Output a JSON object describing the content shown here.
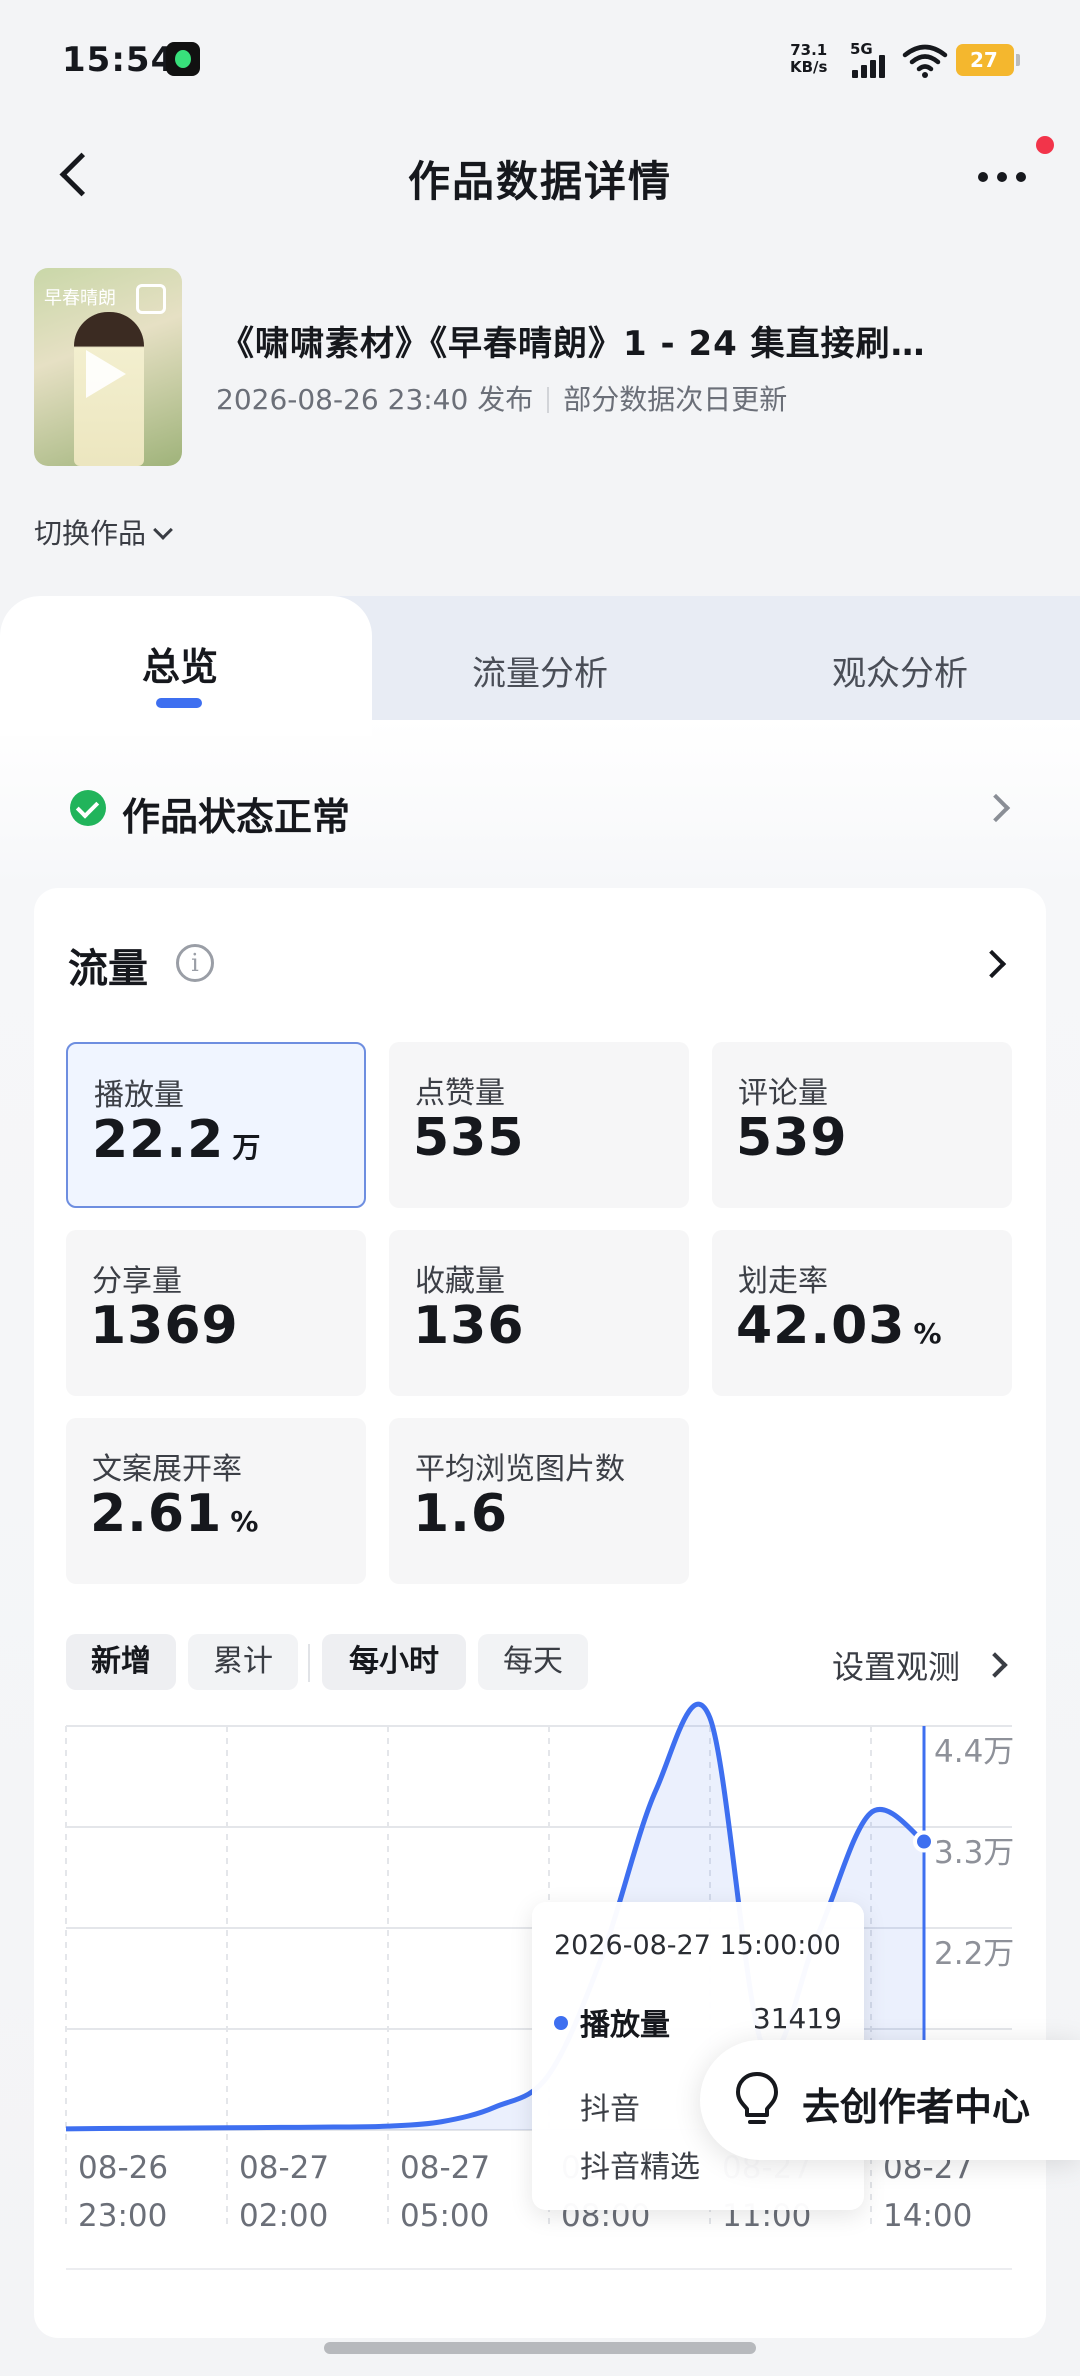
{
  "status_bar": {
    "time": "15:54",
    "net_speed_value": "73.1",
    "net_speed_unit": "KB/s",
    "network": "5G",
    "battery": "27",
    "icons": [
      "app-notification-icon",
      "signal-icon",
      "wifi-icon",
      "battery-icon"
    ]
  },
  "nav": {
    "title": "作品数据详情",
    "back_icon": "chevron-left-icon",
    "more_icon": "more-dots-icon"
  },
  "work": {
    "thumb_label": "早春晴朗",
    "title": "《啸啸素材》《早春晴朗》1 - 24 集直接刷…",
    "publish_time": "2026-08-26 23:40 发布",
    "note": "部分数据次日更新",
    "switch_label": "切换作品"
  },
  "tabs": [
    {
      "label": "总览",
      "active": true
    },
    {
      "label": "流量分析",
      "active": false
    },
    {
      "label": "观众分析",
      "active": false
    }
  ],
  "status": {
    "text": "作品状态正常"
  },
  "traffic": {
    "title": "流量",
    "metrics": [
      {
        "label": "播放量",
        "value": "22.2",
        "unit": "万",
        "selected": true
      },
      {
        "label": "点赞量",
        "value": "535",
        "unit": ""
      },
      {
        "label": "评论量",
        "value": "539",
        "unit": ""
      },
      {
        "label": "分享量",
        "value": "1369",
        "unit": ""
      },
      {
        "label": "收藏量",
        "value": "136",
        "unit": ""
      },
      {
        "label": "划走率",
        "value": "42.03",
        "unit": "%"
      },
      {
        "label": "文案展开率",
        "value": "2.61",
        "unit": "%"
      },
      {
        "label": "平均浏览图片数",
        "value": "1.6",
        "unit": ""
      }
    ],
    "chips": {
      "new": "新增",
      "cumulative": "累计",
      "hourly": "每小时",
      "daily": "每天"
    },
    "set_observe": "设置观测"
  },
  "chart_data": {
    "type": "area",
    "series": [
      {
        "name": "播放量",
        "x": [
          "2026-08-26 23:00",
          "2026-08-27 00:00",
          "2026-08-27 01:00",
          "2026-08-27 02:00",
          "2026-08-27 03:00",
          "2026-08-27 04:00",
          "2026-08-27 05:00",
          "2026-08-27 06:00",
          "2026-08-27 07:00",
          "2026-08-27 08:00",
          "2026-08-27 09:00",
          "2026-08-27 10:00",
          "2026-08-27 11:00",
          "2026-08-27 12:00",
          "2026-08-27 13:00",
          "2026-08-27 14:00",
          "2026-08-27 15:00"
        ],
        "values": [
          120,
          180,
          200,
          240,
          280,
          320,
          420,
          900,
          2500,
          6000,
          19000,
          37000,
          45000,
          9000,
          21000,
          34500,
          31419
        ]
      }
    ],
    "x_tick_labels": [
      [
        "08-26",
        "23:00"
      ],
      [
        "08-27",
        "02:00"
      ],
      [
        "08-27",
        "05:00"
      ],
      [
        "08-27",
        "08:00"
      ],
      [
        "08-27",
        "11:00"
      ],
      [
        "08-27",
        "14:00"
      ]
    ],
    "y_tick_labels": [
      "4.4万",
      "3.3万",
      "2.2万",
      "1.1万",
      "0"
    ],
    "ylim": [
      0,
      44000
    ],
    "grid": true,
    "color": "#3e6ff0"
  },
  "tooltip": {
    "time": "2026-08-27 15:00:00",
    "series_label": "播放量",
    "value": "31419",
    "sub1": "抖音",
    "sub2": "抖音精选"
  },
  "creator_button": {
    "label": "去创作者中心",
    "icon": "lightbulb-icon"
  }
}
